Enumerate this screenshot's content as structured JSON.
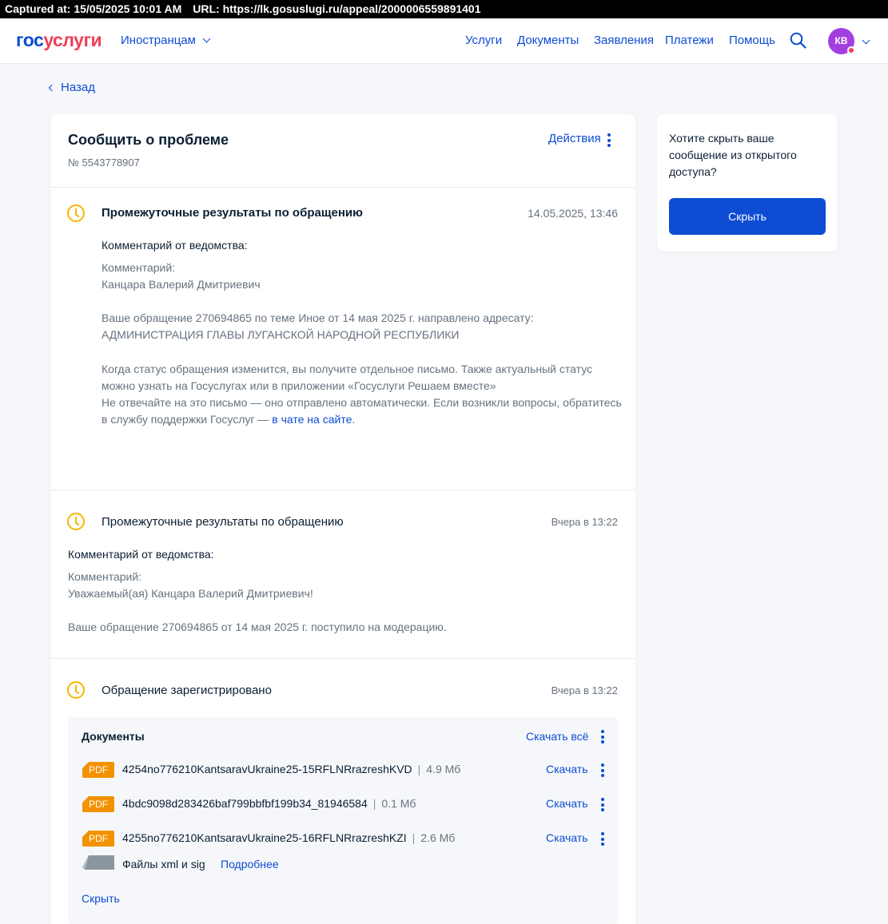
{
  "capture": {
    "captured_at": "Captured at: 15/05/2025 10:01 AM",
    "url": "URL: https://lk.gosuslugi.ru/appeal/2000006559891401"
  },
  "header": {
    "logo_part1": "гос",
    "logo_part2": "услуги",
    "foreigners": "Иностранцам",
    "nav": [
      "Услуги",
      "Документы",
      "Заявления",
      "Платежи",
      "Помощь"
    ],
    "avatar_initials": "КВ"
  },
  "back_label": "Назад",
  "appeal": {
    "title": "Сообщить о проблеме",
    "number": "№ 5543778907",
    "actions_label": "Действия"
  },
  "events": [
    {
      "title": "Промежуточные результаты по обращению",
      "date": "14.05.2025, 13:46",
      "comment_heading": "Комментарий от ведомства:",
      "lines": [
        "Комментарий:",
        "Канцара Валерий Дмитриевич",
        "Ваше обращение 270694865 по теме Иное от 14 мая 2025 г. направлено адресату:",
        "АДМИНИСТРАЦИЯ ГЛАВЫ ЛУГАНСКОЙ НАРОДНОЙ РЕСПУБЛИКИ",
        "Когда статус обращения изменится, вы получите отдельное письмо. Также актуальный статус",
        "можно узнать на Госуслугах или в приложении «Госуслуги Решаем вместе»",
        "Не отвечайте на это письмо — оно отправлено автоматически. Если возникли вопросы, обратитесь",
        "в службу поддержки Госуслуг — "
      ],
      "chat_link": "в чате на сайте",
      "chat_link_tail": "."
    },
    {
      "title": "Промежуточные результаты по обращению",
      "date": "Вчера в 13:22",
      "comment_heading": "Комментарий от ведомства:",
      "lines": [
        "Комментарий:",
        "Уважаемый(ая) Канцара Валерий Дмитриевич!",
        "Ваше обращение 270694865 от 14 мая 2025 г. поступило на модерацию."
      ]
    },
    {
      "title": "Обращение зарегистрировано",
      "date": "Вчера в 13:22"
    }
  ],
  "documents": {
    "title": "Документы",
    "download_all": "Скачать всё",
    "files": [
      {
        "type": "PDF",
        "name": "4254no776210KantsaravUkraine25-15RFLNRrazreshKVD",
        "size": "4.9 Мб",
        "download": "Скачать"
      },
      {
        "type": "PDF",
        "name": "4bdc9098d283426baf799bbfbf199b34_81946584",
        "size": "0.1 Мб",
        "download": "Скачать"
      },
      {
        "type": "PDF",
        "name": "4255no776210KantsaravUkraine25-16RFLNRrazreshKZI",
        "size": "2.6 Мб",
        "download": "Скачать"
      }
    ],
    "xml_label": "Файлы xml и sig",
    "more": "Подробнее",
    "hide": "Скрыть"
  },
  "side": {
    "question": "Хотите скрыть ваше сообщение из открытого доступа?",
    "button": "Скрыть"
  },
  "colors": {
    "primary": "#0d4cd3",
    "brand_red": "#ee3f58",
    "clock": "#f5b800",
    "pdf": "#f39200",
    "avatar": "#a33fe0"
  }
}
